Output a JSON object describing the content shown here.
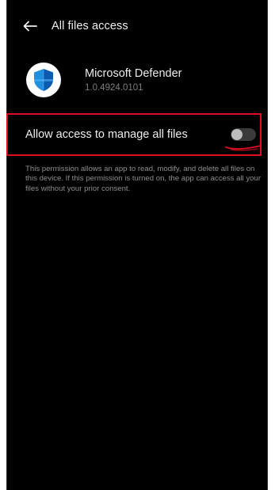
{
  "header": {
    "back_icon": "arrow-left-icon",
    "title": "All files access"
  },
  "app": {
    "icon": "defender-shield-icon",
    "name": "Microsoft Defender",
    "version": "1.0.4924.0101"
  },
  "permission": {
    "label": "Allow access to manage all files",
    "toggle_state": "off",
    "description": "This permission allows an app to read, modify, and delete all files on this device. If this permission is turned on, the app can access all your files without your prior consent."
  },
  "annotation": {
    "highlight_color": "#e00d1d"
  },
  "colors": {
    "background": "#000000",
    "accent_shield": "#1f8fe0"
  }
}
